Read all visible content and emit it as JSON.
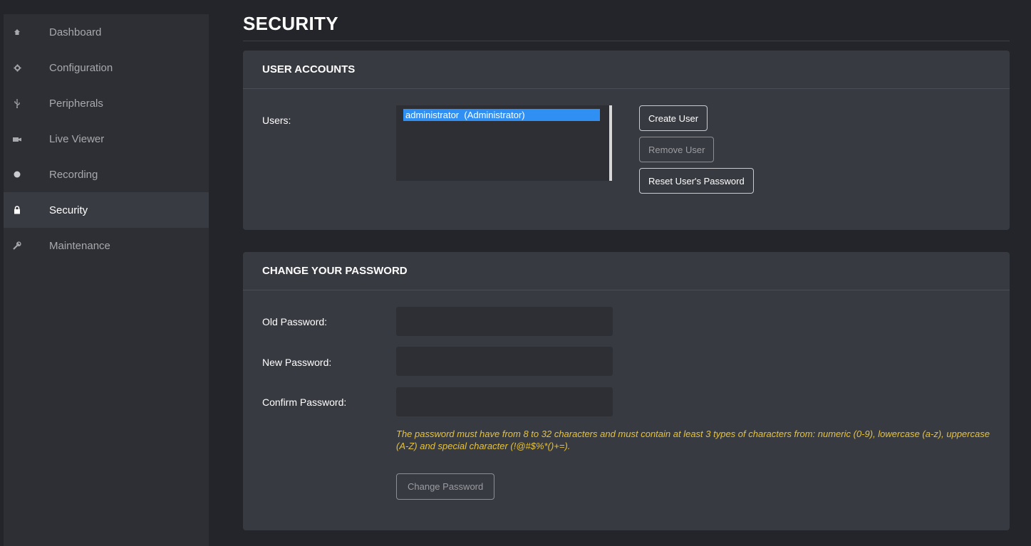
{
  "sidebar": {
    "items": [
      {
        "label": "Dashboard",
        "icon": "home-icon"
      },
      {
        "label": "Configuration",
        "icon": "gear-icon"
      },
      {
        "label": "Peripherals",
        "icon": "usb-icon"
      },
      {
        "label": "Live Viewer",
        "icon": "camera-icon"
      },
      {
        "label": "Recording",
        "icon": "record-dot-icon"
      },
      {
        "label": "Security",
        "icon": "lock-icon",
        "active": true
      },
      {
        "label": "Maintenance",
        "icon": "wrench-icon"
      }
    ]
  },
  "page": {
    "title": "SECURITY"
  },
  "user_accounts": {
    "header": "USER ACCOUNTS",
    "users_label": "Users:",
    "users": [
      "administrator  (Administrator)"
    ],
    "selected_user": "administrator  (Administrator)",
    "create_label": "Create User",
    "remove_label": "Remove User",
    "reset_label": "Reset User's Password"
  },
  "change_password": {
    "header": "CHANGE YOUR PASSWORD",
    "old_label": "Old Password:",
    "new_label": "New Password:",
    "confirm_label": "Confirm Password:",
    "old_value": "",
    "new_value": "",
    "confirm_value": "",
    "hint": "The password must have from 8 to 32 characters and must contain at least 3 types of characters from: numeric (0-9), lowercase (a-z), uppercase (A-Z) and special character (!@#$%*()+=).",
    "submit_label": "Change Password"
  },
  "colors": {
    "background": "#23252b",
    "sidebar": "#2d2f35",
    "panel": "#383a42",
    "selection": "#2f8ff3",
    "hint": "#e5c23b"
  }
}
